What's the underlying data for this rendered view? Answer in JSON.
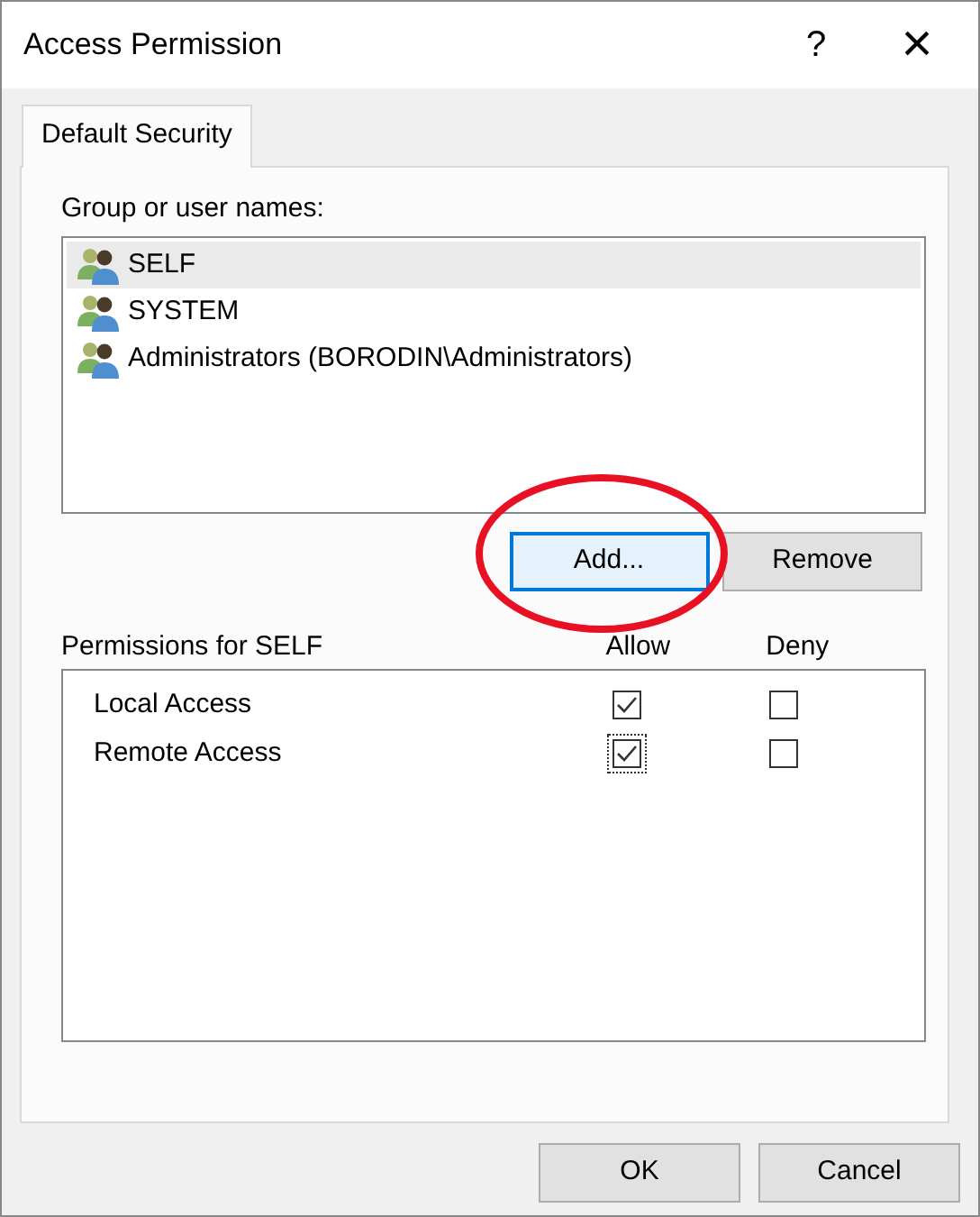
{
  "window": {
    "title": "Access Permission",
    "help": "?",
    "close": "×"
  },
  "tabs": [
    {
      "label": "Default Security",
      "selected": true
    }
  ],
  "users": {
    "label": "Group or user names:",
    "items": [
      {
        "name": "SELF",
        "selected": true
      },
      {
        "name": "SYSTEM",
        "selected": false
      },
      {
        "name": "Administrators (BORODIN\\Administrators)",
        "selected": false
      }
    ]
  },
  "user_buttons": [
    {
      "label": "Add...",
      "focused": true
    },
    {
      "label": "Remove",
      "focused": false
    }
  ],
  "permissions": {
    "label": "Permissions for SELF",
    "columns": [
      "Allow",
      "Deny"
    ],
    "rows": [
      {
        "name": "Local Access",
        "allow": {
          "checked": true
        },
        "deny": {
          "checked": false
        }
      },
      {
        "name": "Remote Access",
        "allow": {
          "checked": true,
          "focused": true
        },
        "deny": {
          "checked": false
        }
      }
    ]
  },
  "highlight": {
    "kind": "ellipse",
    "color": "#e81123"
  },
  "buttons": [
    {
      "label": "OK"
    },
    {
      "label": "Cancel"
    }
  ]
}
